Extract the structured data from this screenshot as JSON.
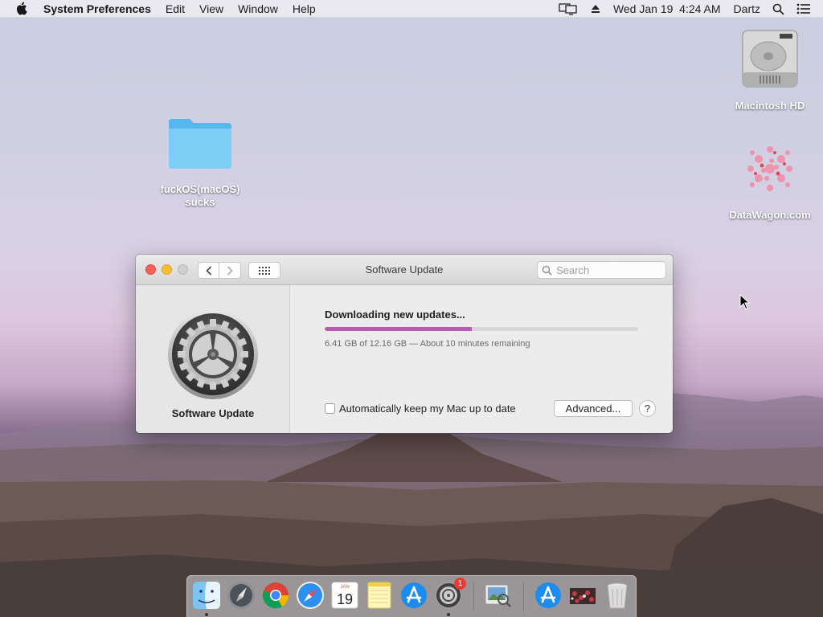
{
  "menubar": {
    "app_name": "System Preferences",
    "menus": [
      "Edit",
      "View",
      "Window",
      "Help"
    ],
    "clock": "Wed Jan 19  4:24 AM",
    "user": "Dartz"
  },
  "desktop": {
    "icons": [
      {
        "label": "Macintosh HD",
        "icon": "hard-drive-icon"
      },
      {
        "label": "DataWagon.com",
        "icon": "datawagon-icon"
      },
      {
        "label_line1": "fuckOS(macOS)",
        "label_line2": "sucks",
        "icon": "folder-icon"
      }
    ]
  },
  "window": {
    "title": "Software Update",
    "search_placeholder": "Search",
    "sidebar": {
      "label": "Software Update",
      "icon": "gear-icon"
    },
    "status": {
      "title": "Downloading new updates...",
      "progress_fraction": 0.47,
      "detail": "6.41 GB of 12.16 GB — About 10 minutes remaining"
    },
    "auto_update": {
      "label": "Automatically keep my Mac up to date",
      "checked": false
    },
    "advanced_label": "Advanced...",
    "help_label": "?"
  },
  "dock": {
    "items": [
      {
        "name": "Finder",
        "icon": "finder-icon",
        "running": true
      },
      {
        "name": "Launchpad",
        "icon": "launchpad-icon"
      },
      {
        "name": "Chrome",
        "icon": "chrome-icon"
      },
      {
        "name": "Safari",
        "icon": "safari-icon"
      },
      {
        "name": "Calendar",
        "icon": "calendar-icon",
        "month": "JAN",
        "day": "19"
      },
      {
        "name": "Notes",
        "icon": "notes-icon"
      },
      {
        "name": "App Store",
        "icon": "app-store-icon"
      },
      {
        "name": "System Preferences",
        "icon": "system-preferences-icon",
        "running": true,
        "badge": "1"
      },
      {
        "name": "Preview",
        "icon": "preview-icon"
      },
      {
        "name": "Downloads",
        "icon": "downloads-stack-icon"
      },
      {
        "name": "Photos",
        "icon": "photos-stack-icon"
      },
      {
        "name": "Trash",
        "icon": "trash-icon"
      }
    ]
  },
  "colors": {
    "close": "#fc5f57",
    "minimize": "#fdbc2e",
    "progress": "#b65cb0",
    "badge": "#f03a31"
  }
}
